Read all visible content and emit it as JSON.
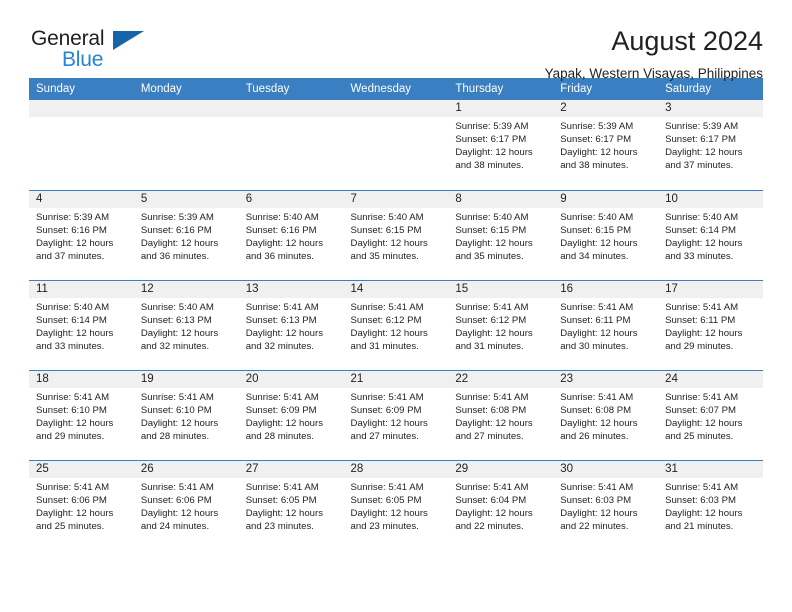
{
  "brand": {
    "name_primary": "General",
    "name_secondary": "Blue",
    "triangle_color": "#1565a8",
    "blue_color": "#2585d3"
  },
  "header": {
    "month_title": "August 2024",
    "location": "Yapak, Western Visayas, Philippines"
  },
  "theme": {
    "header_bar_color": "#3a7fc1",
    "daynum_strip_color": "#f0f0f0",
    "text_color": "#231f20"
  },
  "calendar": {
    "weekday_headers": [
      "Sunday",
      "Monday",
      "Tuesday",
      "Wednesday",
      "Thursday",
      "Friday",
      "Saturday"
    ],
    "labels": {
      "sunrise": "Sunrise:",
      "sunset": "Sunset:",
      "daylight": "Daylight:"
    },
    "weeks": [
      [
        {
          "day": "",
          "empty": true
        },
        {
          "day": "",
          "empty": true
        },
        {
          "day": "",
          "empty": true
        },
        {
          "day": "",
          "empty": true
        },
        {
          "day": "1",
          "sunrise": "Sunrise: 5:39 AM",
          "sunset": "Sunset: 6:17 PM",
          "daylight_1": "Daylight: 12 hours",
          "daylight_2": "and 38 minutes."
        },
        {
          "day": "2",
          "sunrise": "Sunrise: 5:39 AM",
          "sunset": "Sunset: 6:17 PM",
          "daylight_1": "Daylight: 12 hours",
          "daylight_2": "and 38 minutes."
        },
        {
          "day": "3",
          "sunrise": "Sunrise: 5:39 AM",
          "sunset": "Sunset: 6:17 PM",
          "daylight_1": "Daylight: 12 hours",
          "daylight_2": "and 37 minutes."
        }
      ],
      [
        {
          "day": "4",
          "sunrise": "Sunrise: 5:39 AM",
          "sunset": "Sunset: 6:16 PM",
          "daylight_1": "Daylight: 12 hours",
          "daylight_2": "and 37 minutes."
        },
        {
          "day": "5",
          "sunrise": "Sunrise: 5:39 AM",
          "sunset": "Sunset: 6:16 PM",
          "daylight_1": "Daylight: 12 hours",
          "daylight_2": "and 36 minutes."
        },
        {
          "day": "6",
          "sunrise": "Sunrise: 5:40 AM",
          "sunset": "Sunset: 6:16 PM",
          "daylight_1": "Daylight: 12 hours",
          "daylight_2": "and 36 minutes."
        },
        {
          "day": "7",
          "sunrise": "Sunrise: 5:40 AM",
          "sunset": "Sunset: 6:15 PM",
          "daylight_1": "Daylight: 12 hours",
          "daylight_2": "and 35 minutes."
        },
        {
          "day": "8",
          "sunrise": "Sunrise: 5:40 AM",
          "sunset": "Sunset: 6:15 PM",
          "daylight_1": "Daylight: 12 hours",
          "daylight_2": "and 35 minutes."
        },
        {
          "day": "9",
          "sunrise": "Sunrise: 5:40 AM",
          "sunset": "Sunset: 6:15 PM",
          "daylight_1": "Daylight: 12 hours",
          "daylight_2": "and 34 minutes."
        },
        {
          "day": "10",
          "sunrise": "Sunrise: 5:40 AM",
          "sunset": "Sunset: 6:14 PM",
          "daylight_1": "Daylight: 12 hours",
          "daylight_2": "and 33 minutes."
        }
      ],
      [
        {
          "day": "11",
          "sunrise": "Sunrise: 5:40 AM",
          "sunset": "Sunset: 6:14 PM",
          "daylight_1": "Daylight: 12 hours",
          "daylight_2": "and 33 minutes."
        },
        {
          "day": "12",
          "sunrise": "Sunrise: 5:40 AM",
          "sunset": "Sunset: 6:13 PM",
          "daylight_1": "Daylight: 12 hours",
          "daylight_2": "and 32 minutes."
        },
        {
          "day": "13",
          "sunrise": "Sunrise: 5:41 AM",
          "sunset": "Sunset: 6:13 PM",
          "daylight_1": "Daylight: 12 hours",
          "daylight_2": "and 32 minutes."
        },
        {
          "day": "14",
          "sunrise": "Sunrise: 5:41 AM",
          "sunset": "Sunset: 6:12 PM",
          "daylight_1": "Daylight: 12 hours",
          "daylight_2": "and 31 minutes."
        },
        {
          "day": "15",
          "sunrise": "Sunrise: 5:41 AM",
          "sunset": "Sunset: 6:12 PM",
          "daylight_1": "Daylight: 12 hours",
          "daylight_2": "and 31 minutes."
        },
        {
          "day": "16",
          "sunrise": "Sunrise: 5:41 AM",
          "sunset": "Sunset: 6:11 PM",
          "daylight_1": "Daylight: 12 hours",
          "daylight_2": "and 30 minutes."
        },
        {
          "day": "17",
          "sunrise": "Sunrise: 5:41 AM",
          "sunset": "Sunset: 6:11 PM",
          "daylight_1": "Daylight: 12 hours",
          "daylight_2": "and 29 minutes."
        }
      ],
      [
        {
          "day": "18",
          "sunrise": "Sunrise: 5:41 AM",
          "sunset": "Sunset: 6:10 PM",
          "daylight_1": "Daylight: 12 hours",
          "daylight_2": "and 29 minutes."
        },
        {
          "day": "19",
          "sunrise": "Sunrise: 5:41 AM",
          "sunset": "Sunset: 6:10 PM",
          "daylight_1": "Daylight: 12 hours",
          "daylight_2": "and 28 minutes."
        },
        {
          "day": "20",
          "sunrise": "Sunrise: 5:41 AM",
          "sunset": "Sunset: 6:09 PM",
          "daylight_1": "Daylight: 12 hours",
          "daylight_2": "and 28 minutes."
        },
        {
          "day": "21",
          "sunrise": "Sunrise: 5:41 AM",
          "sunset": "Sunset: 6:09 PM",
          "daylight_1": "Daylight: 12 hours",
          "daylight_2": "and 27 minutes."
        },
        {
          "day": "22",
          "sunrise": "Sunrise: 5:41 AM",
          "sunset": "Sunset: 6:08 PM",
          "daylight_1": "Daylight: 12 hours",
          "daylight_2": "and 27 minutes."
        },
        {
          "day": "23",
          "sunrise": "Sunrise: 5:41 AM",
          "sunset": "Sunset: 6:08 PM",
          "daylight_1": "Daylight: 12 hours",
          "daylight_2": "and 26 minutes."
        },
        {
          "day": "24",
          "sunrise": "Sunrise: 5:41 AM",
          "sunset": "Sunset: 6:07 PM",
          "daylight_1": "Daylight: 12 hours",
          "daylight_2": "and 25 minutes."
        }
      ],
      [
        {
          "day": "25",
          "sunrise": "Sunrise: 5:41 AM",
          "sunset": "Sunset: 6:06 PM",
          "daylight_1": "Daylight: 12 hours",
          "daylight_2": "and 25 minutes."
        },
        {
          "day": "26",
          "sunrise": "Sunrise: 5:41 AM",
          "sunset": "Sunset: 6:06 PM",
          "daylight_1": "Daylight: 12 hours",
          "daylight_2": "and 24 minutes."
        },
        {
          "day": "27",
          "sunrise": "Sunrise: 5:41 AM",
          "sunset": "Sunset: 6:05 PM",
          "daylight_1": "Daylight: 12 hours",
          "daylight_2": "and 23 minutes."
        },
        {
          "day": "28",
          "sunrise": "Sunrise: 5:41 AM",
          "sunset": "Sunset: 6:05 PM",
          "daylight_1": "Daylight: 12 hours",
          "daylight_2": "and 23 minutes."
        },
        {
          "day": "29",
          "sunrise": "Sunrise: 5:41 AM",
          "sunset": "Sunset: 6:04 PM",
          "daylight_1": "Daylight: 12 hours",
          "daylight_2": "and 22 minutes."
        },
        {
          "day": "30",
          "sunrise": "Sunrise: 5:41 AM",
          "sunset": "Sunset: 6:03 PM",
          "daylight_1": "Daylight: 12 hours",
          "daylight_2": "and 22 minutes."
        },
        {
          "day": "31",
          "sunrise": "Sunrise: 5:41 AM",
          "sunset": "Sunset: 6:03 PM",
          "daylight_1": "Daylight: 12 hours",
          "daylight_2": "and 21 minutes."
        }
      ]
    ]
  }
}
